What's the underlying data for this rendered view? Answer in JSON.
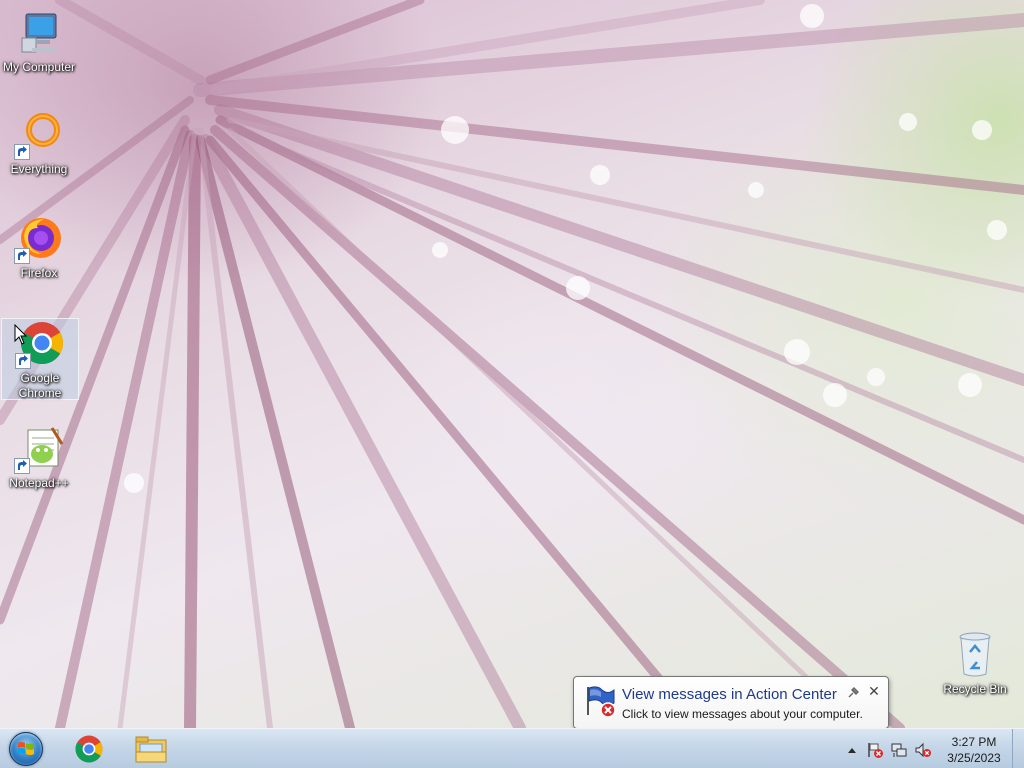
{
  "desktop": {
    "icons": [
      {
        "label": "My Computer"
      },
      {
        "label": "Everything"
      },
      {
        "label": "Firefox"
      },
      {
        "label": "Google Chrome"
      },
      {
        "label": "Notepad++"
      },
      {
        "label": "Recycle Bin"
      }
    ]
  },
  "notification": {
    "title": "View messages in Action Center",
    "message": "Click to view messages about your computer.",
    "close_glyph": "✕"
  },
  "taskbar": {
    "pinned": [
      "Google Chrome",
      "Windows Explorer"
    ],
    "clock": {
      "time": "3:27 PM",
      "date": "3/25/2023"
    },
    "tray_icons": [
      "show-hidden-icons",
      "action-center-flag-error",
      "network",
      "volume-muted"
    ]
  },
  "colors": {
    "balloon_title": "#1e3a8a",
    "taskbar_top": "#dbe7f3",
    "taskbar_bottom": "#b7cbe0"
  }
}
